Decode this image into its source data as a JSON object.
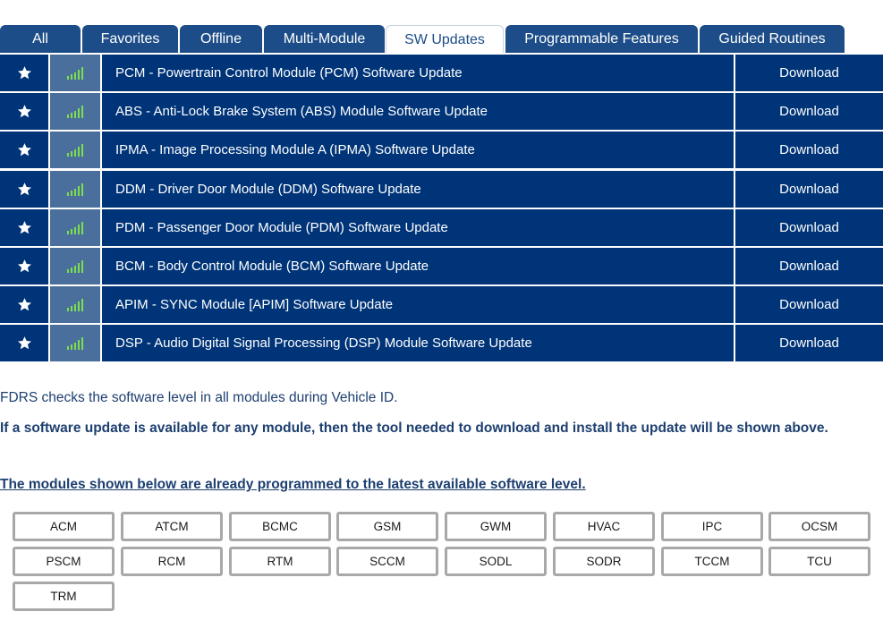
{
  "tabs": [
    {
      "label": "All",
      "active": false
    },
    {
      "label": "Favorites",
      "active": false
    },
    {
      "label": "Offline",
      "active": false
    },
    {
      "label": "Multi-Module",
      "active": false
    },
    {
      "label": "SW Updates",
      "active": true
    },
    {
      "label": "Programmable Features",
      "active": false
    },
    {
      "label": "Guided Routines",
      "active": false
    }
  ],
  "rows": [
    {
      "name": "PCM - Powertrain Control Module (PCM) Software Update",
      "action": "Download"
    },
    {
      "name": "ABS - Anti-Lock Brake System (ABS) Module Software Update",
      "action": "Download"
    },
    {
      "name": "IPMA - Image Processing Module A (IPMA) Software Update",
      "action": "Download"
    },
    {
      "name": "DDM - Driver Door Module (DDM) Software Update",
      "action": "Download"
    },
    {
      "name": "PDM - Passenger Door Module (PDM) Software Update",
      "action": "Download"
    },
    {
      "name": "BCM - Body Control Module (BCM) Software Update",
      "action": "Download"
    },
    {
      "name": "APIM - SYNC Module [APIM] Software Update",
      "action": "Download"
    },
    {
      "name": "DSP - Audio Digital Signal Processing (DSP) Module Software Update",
      "action": "Download"
    }
  ],
  "icons": {
    "favorite": "star-icon",
    "signal": "signal-strength-icon"
  },
  "colors": {
    "tab_bg": "#1d4d88",
    "row_bg": "#003478",
    "signal_bg": "#4a6f9c",
    "signal_bars": "#7ddf4c",
    "text": "#1d3f70"
  },
  "info": {
    "line1": "FDRS checks the software level in all modules during Vehicle ID.",
    "line2": "If a software update is available for any module, then the tool needed to download and install the update will be shown above.",
    "line3": "The modules shown below are already programmed to the latest available software level."
  },
  "modules": [
    "ACM",
    "ATCM",
    "BCMC",
    "GSM",
    "GWM",
    "HVAC",
    "IPC",
    "OCSM",
    "PSCM",
    "RCM",
    "RTM",
    "SCCM",
    "SODL",
    "SODR",
    "TCCM",
    "TCU",
    "TRM"
  ]
}
